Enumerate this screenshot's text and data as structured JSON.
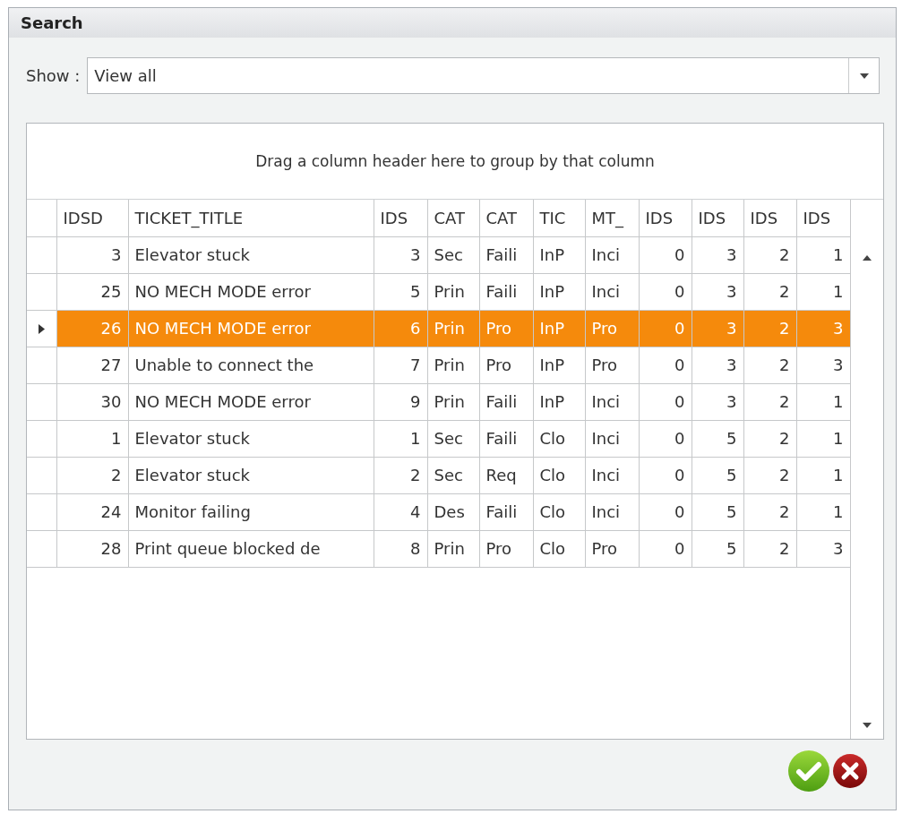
{
  "window": {
    "title": "Search"
  },
  "filter": {
    "label": "Show :",
    "value": "View all"
  },
  "group_panel": {
    "text": "Drag a column header here to group by that column"
  },
  "table": {
    "columns": [
      "IDSD",
      "TICKET_TITLE",
      "IDS",
      "CAT",
      "CAT",
      "TIC",
      "MT_",
      "IDS",
      "IDS",
      "IDS",
      "IDS"
    ],
    "rows": [
      {
        "selected": false,
        "cells": [
          "3",
          "Elevator stuck",
          "3",
          "Sec",
          "Faili",
          "InP",
          "Inci",
          "0",
          "3",
          "2",
          "1"
        ]
      },
      {
        "selected": false,
        "cells": [
          "25",
          "NO MECH MODE error",
          "5",
          "Prin",
          "Faili",
          "InP",
          "Inci",
          "0",
          "3",
          "2",
          "1"
        ]
      },
      {
        "selected": true,
        "cells": [
          "26",
          "NO MECH MODE error",
          "6",
          "Prin",
          "Pro",
          "InP",
          "Pro",
          "0",
          "3",
          "2",
          "3"
        ]
      },
      {
        "selected": false,
        "cells": [
          "27",
          "Unable to connect the",
          "7",
          "Prin",
          "Pro",
          "InP",
          "Pro",
          "0",
          "3",
          "2",
          "3"
        ]
      },
      {
        "selected": false,
        "cells": [
          "30",
          "NO MECH MODE error",
          "9",
          "Prin",
          "Faili",
          "InP",
          "Inci",
          "0",
          "3",
          "2",
          "1"
        ]
      },
      {
        "selected": false,
        "cells": [
          "1",
          "Elevator stuck",
          "1",
          "Sec",
          "Faili",
          "Clo",
          "Inci",
          "0",
          "5",
          "2",
          "1"
        ]
      },
      {
        "selected": false,
        "cells": [
          "2",
          "Elevator stuck",
          "2",
          "Sec",
          "Req",
          "Clo",
          "Inci",
          "0",
          "5",
          "2",
          "1"
        ]
      },
      {
        "selected": false,
        "cells": [
          "24",
          "Monitor failing",
          "4",
          "Des",
          "Faili",
          "Clo",
          "Inci",
          "0",
          "5",
          "2",
          "1"
        ]
      },
      {
        "selected": false,
        "cells": [
          "28",
          "Print queue blocked de",
          "8",
          "Prin",
          "Pro",
          "Clo",
          "Pro",
          "0",
          "5",
          "2",
          "3"
        ]
      }
    ]
  }
}
